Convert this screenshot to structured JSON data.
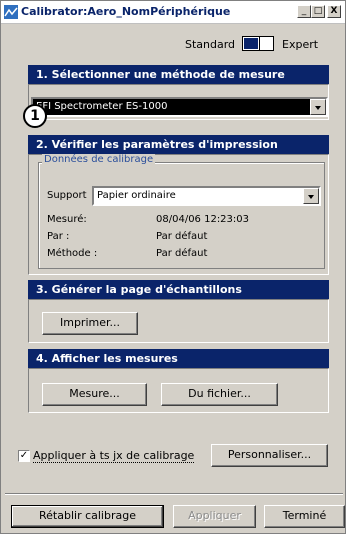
{
  "window": {
    "title": "Calibrator:Aero_NomPériphérique",
    "minimize_glyph": "_",
    "maximize_glyph": "□",
    "close_glyph": "X"
  },
  "mode": {
    "standard_label": "Standard",
    "expert_label": "Expert"
  },
  "step_badge": "1",
  "sections": {
    "s1": {
      "title": "1. Sélectionner une méthode de mesure",
      "method_value": "EFI Spectrometer ES-1000"
    },
    "s2": {
      "title": "2. Vérifier les paramètres d'impression",
      "group_label": "Données de calibrage",
      "support_label": "Support",
      "support_value": "Papier ordinaire",
      "measured_label": "Mesuré:",
      "measured_value": "08/04/06 12:23:03",
      "by_label": "Par :",
      "by_value": "Par défaut",
      "method_label": "Méthode :",
      "method_value": "Par défaut"
    },
    "s3": {
      "title": "3. Générer la page d'échantillons",
      "print_button": "Imprimer..."
    },
    "s4": {
      "title": "4. Afficher les mesures",
      "measure_button": "Mesure...",
      "from_file_button": "Du fichier..."
    }
  },
  "apply_all": {
    "label": "Appliquer à ts jx de calibrage",
    "checked_glyph": "✓"
  },
  "customize_button": "Personnaliser...",
  "footer": {
    "restore_button": "Rétablir calibrage",
    "apply_button": "Appliquer",
    "done_button": "Terminé"
  }
}
